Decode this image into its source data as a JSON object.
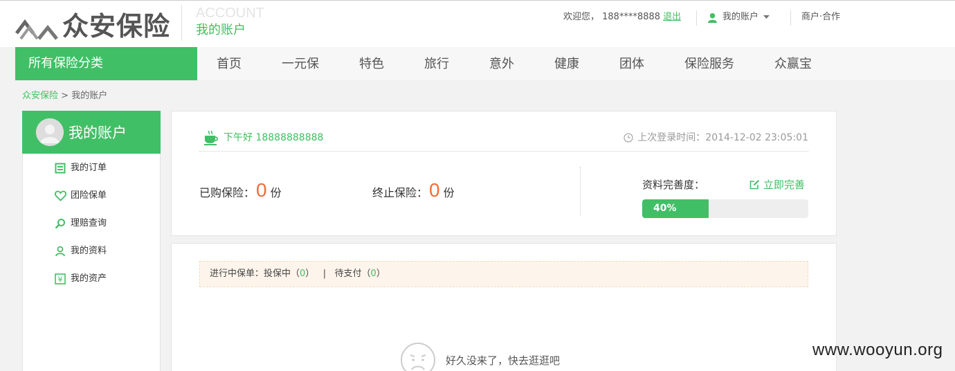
{
  "header": {
    "logo_text": "众安保险",
    "account_en": "ACCOUNT",
    "account_cn": "我的账户",
    "welcome": "欢迎您， 188****8888",
    "logout": "退出",
    "my_account": "我的账户",
    "merchant": "商户·合作"
  },
  "nav": {
    "all_categories": "所有保险分类",
    "items": [
      "首页",
      "一元保",
      "特色",
      "旅行",
      "意外",
      "健康",
      "团体",
      "保险服务",
      "众赢宝"
    ]
  },
  "breadcrumb": {
    "home": "众安保险",
    "sep": ">",
    "current": "我的账户"
  },
  "sidebar": {
    "title": "我的账户",
    "items": [
      {
        "label": "我的订单",
        "icon": "order-icon"
      },
      {
        "label": "团险保单",
        "icon": "heart-icon"
      },
      {
        "label": "理赔查询",
        "icon": "search-icon"
      },
      {
        "label": "我的资料",
        "icon": "user-icon"
      },
      {
        "label": "我的资产",
        "icon": "yen-icon"
      }
    ]
  },
  "summary": {
    "greeting": "下午好 18888888888",
    "last_login": "上次登录时间：2014-12-02 23:05:01",
    "purchased_label": "已购保险：",
    "purchased_count": "0",
    "terminated_label": "终止保险：",
    "terminated_count": "0",
    "unit": "份",
    "completeness_label": "资料完善度：",
    "complete_now": "立即完善",
    "completeness_text": "40%",
    "completeness_value": 40
  },
  "orders": {
    "in_progress_label": "进行中保单：投保中（",
    "insuring_count": "0",
    "close1": "）",
    "divider": "|",
    "pending_label": "待支付（",
    "pending_count": "0",
    "close2": "）",
    "empty_message": "好久没来了，快去逛逛吧"
  },
  "watermark": "www.wooyun.org",
  "colors": {
    "brand_green": "#41bf66",
    "number_orange": "#f46a3a"
  }
}
